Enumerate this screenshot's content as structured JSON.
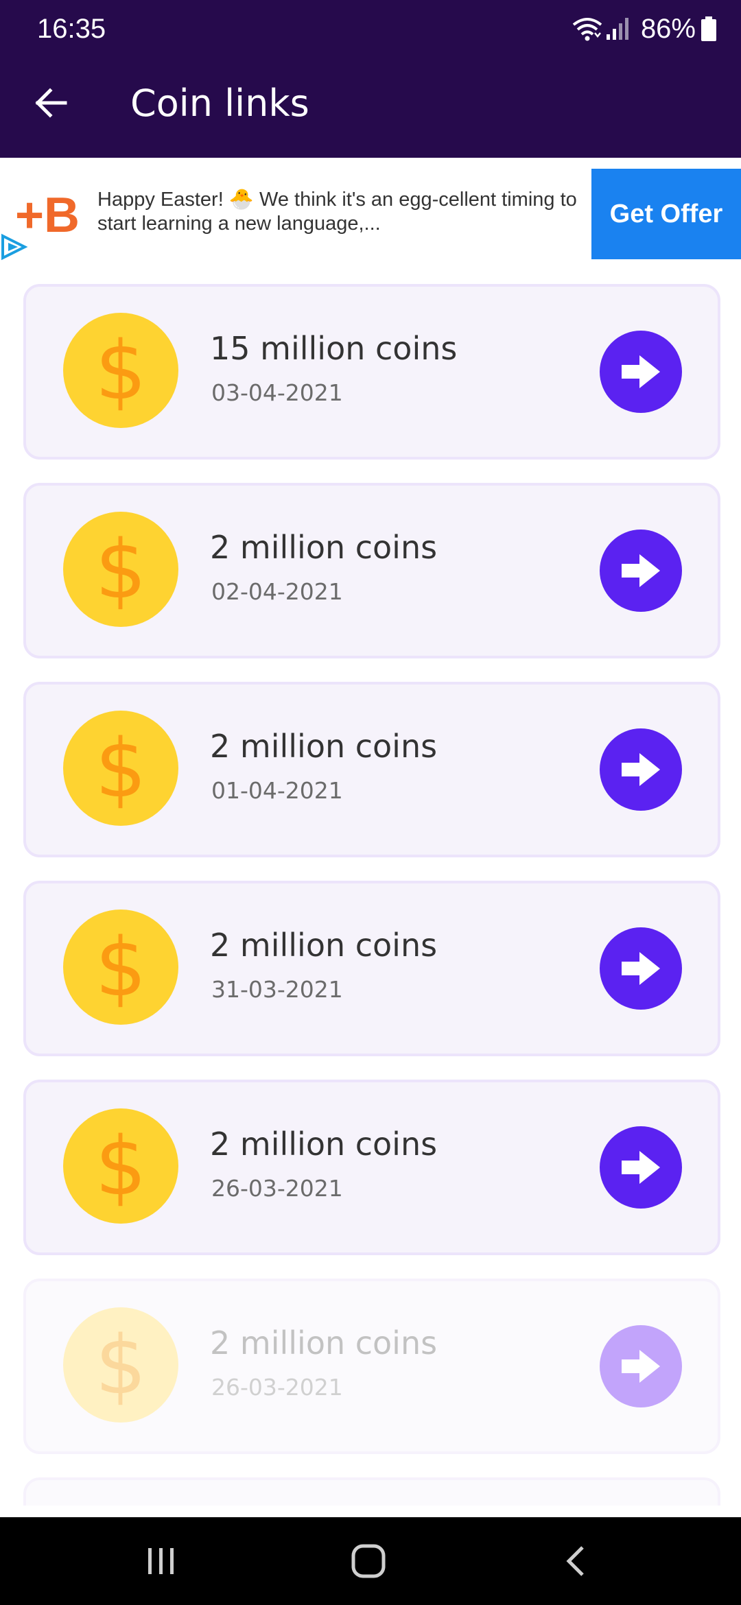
{
  "status_bar": {
    "time": "16:35",
    "battery": "86%",
    "icons": [
      "wifi-icon",
      "signal-icon",
      "battery-icon"
    ]
  },
  "app_bar": {
    "title": "Coin links",
    "back_icon": "back-arrow-icon"
  },
  "ad": {
    "logo": "+B",
    "text": "Happy Easter! 🐣 We think it's an egg-cellent timing to start learning a new language,...",
    "cta": "Get Offer"
  },
  "items": [
    {
      "title": "15 million coins",
      "date": "03-04-2021"
    },
    {
      "title": "2 million coins",
      "date": "02-04-2021"
    },
    {
      "title": "2 million coins",
      "date": "01-04-2021"
    },
    {
      "title": "2 million coins",
      "date": "31-03-2021"
    },
    {
      "title": "2 million coins",
      "date": "26-03-2021"
    },
    {
      "title": "2 million coins",
      "date": "26-03-2021"
    }
  ],
  "coin_symbol": "$",
  "nav": {
    "icons": [
      "recent-apps-icon",
      "home-icon",
      "back-icon"
    ]
  },
  "colors": {
    "header": "#260a4c",
    "accent": "#5b22f1",
    "coin": "#fed331",
    "cta": "#1a82f0"
  }
}
